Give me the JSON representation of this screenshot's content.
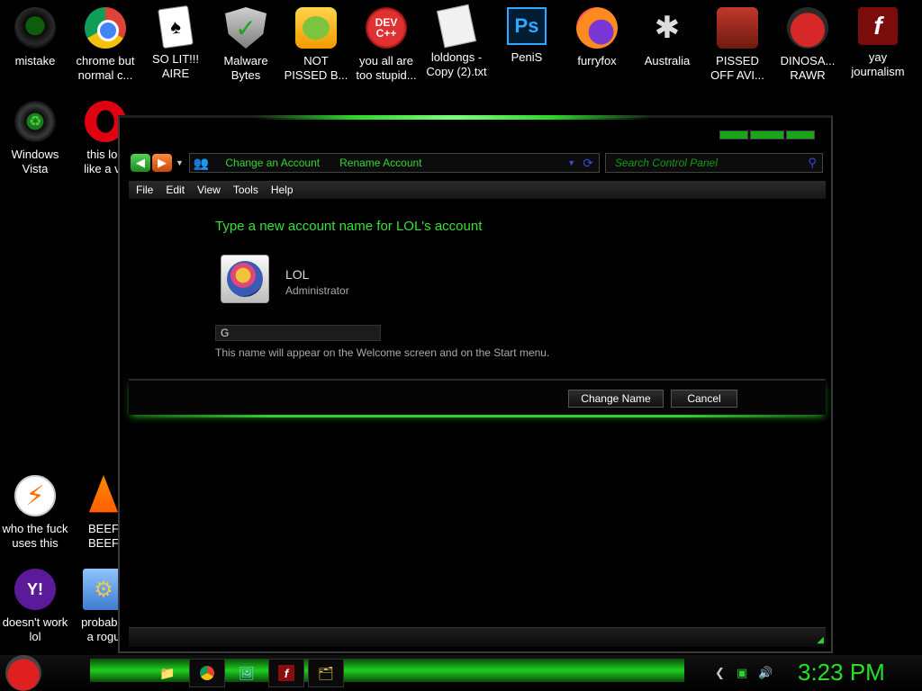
{
  "desktop": {
    "icons": [
      {
        "label": "mistake",
        "icon": "green-orb-icon"
      },
      {
        "label": "chrome but\nnormal c...",
        "icon": "chrome-icon"
      },
      {
        "label": "SO LIT!!!\nAIRE",
        "icon": "playing-card-icon"
      },
      {
        "label": "Malware\nBytes",
        "icon": "shield-check-icon"
      },
      {
        "label": "NOT\nPISSED B...",
        "icon": "green-pig-icon"
      },
      {
        "label": "you all are\ntoo stupid...",
        "icon": "dev-cpp-icon"
      },
      {
        "label": "loldongs -\nCopy (2).txt",
        "icon": "text-file-icon"
      },
      {
        "label": "PeniS",
        "icon": "photoshop-icon"
      },
      {
        "label": "furryfox",
        "icon": "firefox-icon"
      },
      {
        "label": "Australia",
        "icon": "spider-solitaire-icon"
      },
      {
        "label": "PISSED\nOFF AVI...",
        "icon": "angry-birds-seasons-icon"
      },
      {
        "label": "DINOSA...\nRAWR",
        "icon": "angry-bird-icon"
      },
      {
        "label": "yay\njournalism",
        "icon": "flash-icon"
      },
      {
        "label": "Windows\nVista",
        "icon": "recycle-bin-icon"
      },
      {
        "label": "this loo\nlike a va",
        "icon": "opera-icon"
      },
      {
        "label": "who the fuck\nuses this",
        "icon": "bolt-icon"
      },
      {
        "label": "BEEF\nBEEF",
        "icon": "vlc-cone-icon"
      },
      {
        "label": "doesn't work\nlol",
        "icon": "yahoo-messenger-icon"
      },
      {
        "label": "probably\na rogu",
        "icon": "gear-program-icon"
      }
    ]
  },
  "window": {
    "breadcrumbs": [
      "Change an Account",
      "Rename Account"
    ],
    "search_placeholder": "Search Control Panel",
    "menu": [
      "File",
      "Edit",
      "View",
      "Tools",
      "Help"
    ],
    "heading": "Type a new account name for LOL's account",
    "account": {
      "name": "LOL",
      "role": "Administrator"
    },
    "name_input_value": "G",
    "hint": "This name will appear on the Welcome screen and on the Start menu.",
    "buttons": {
      "change": "Change Name",
      "cancel": "Cancel"
    }
  },
  "taskbar": {
    "clock": "3:23 PM"
  },
  "colors": {
    "accent": "#26e026",
    "link": "#33d633",
    "background": "#000000"
  }
}
